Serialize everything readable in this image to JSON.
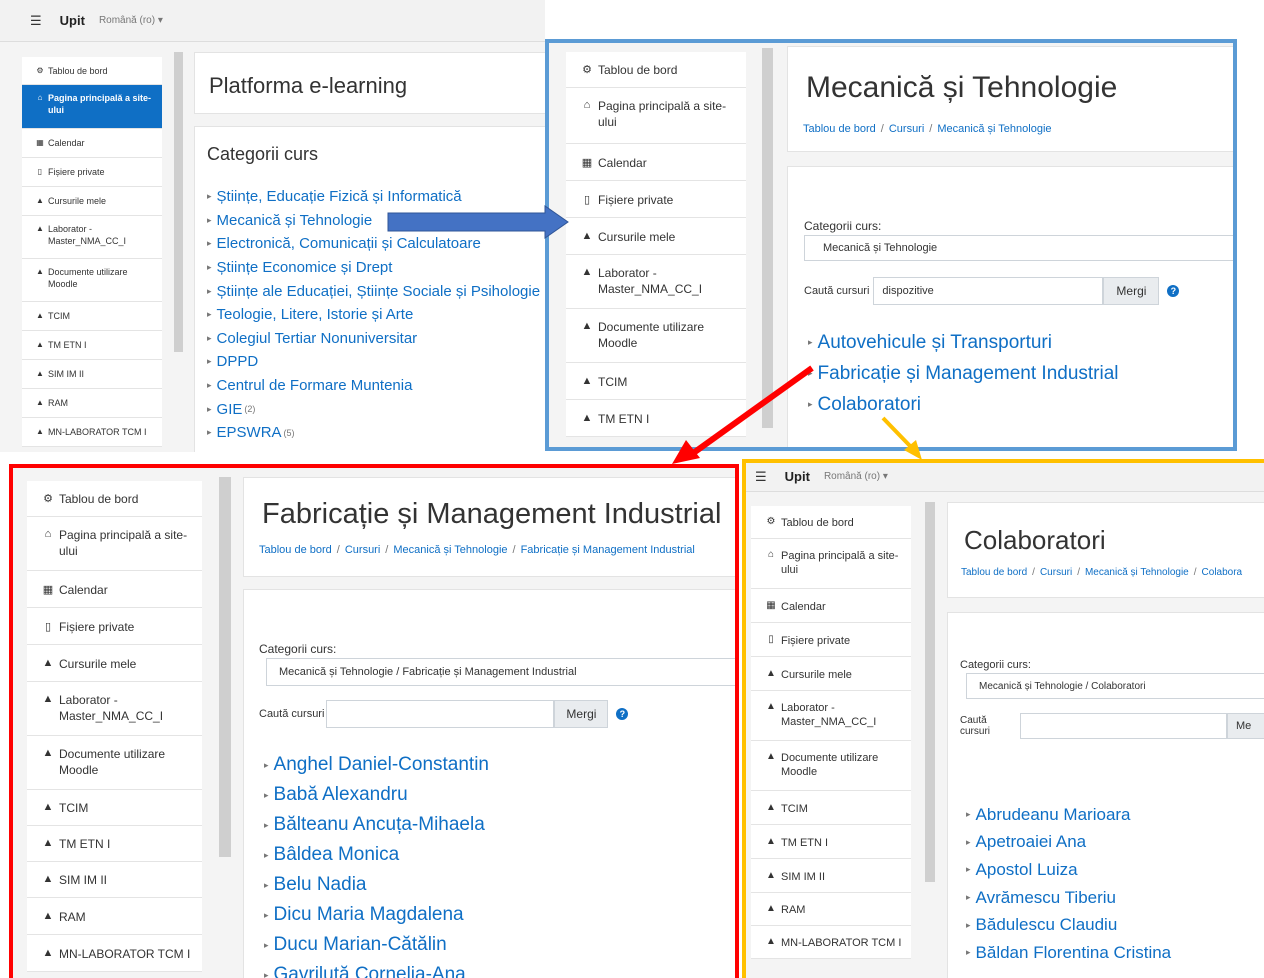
{
  "navbar": {
    "menu_icon": "hamburger-icon",
    "brand": "Upit",
    "lang": "Română (ro) ▾"
  },
  "sidebar_items": [
    {
      "icon": "dashboard-icon",
      "label": "Tablou de bord"
    },
    {
      "icon": "home-icon",
      "label": "Pagina principală a site-ului"
    },
    {
      "icon": "calendar-icon",
      "label": "Calendar"
    },
    {
      "icon": "file-icon",
      "label": "Fișiere private"
    },
    {
      "icon": "graduation-cap-icon",
      "label": "Cursurile mele"
    },
    {
      "icon": "graduation-cap-icon",
      "label": "Laborator - Master_NMA_CC_I"
    },
    {
      "icon": "graduation-cap-icon",
      "label": "Documente utilizare Moodle"
    },
    {
      "icon": "graduation-cap-icon",
      "label": "TCIM"
    },
    {
      "icon": "graduation-cap-icon",
      "label": "TM ETN I"
    },
    {
      "icon": "graduation-cap-icon",
      "label": "SIM IM II"
    },
    {
      "icon": "graduation-cap-icon",
      "label": "RAM"
    },
    {
      "icon": "graduation-cap-icon",
      "label": "MN-LABORATOR TCM I"
    }
  ],
  "panel1": {
    "title": "Platforma e-learning",
    "categories_heading": "Categorii curs",
    "categories": [
      {
        "name": "Științe, Educație Fizică și Informatică",
        "count": ""
      },
      {
        "name": "Mecanică și Tehnologie",
        "count": ""
      },
      {
        "name": "Electronică, Comunicații și Calculatoare",
        "count": ""
      },
      {
        "name": "Științe Economice și Drept",
        "count": ""
      },
      {
        "name": "Științe ale Educației, Științe Sociale și Psihologie",
        "count": ""
      },
      {
        "name": "Teologie, Litere, Istorie și Arte",
        "count": ""
      },
      {
        "name": "Colegiul Tertiar Nonuniversitar",
        "count": ""
      },
      {
        "name": "DPPD",
        "count": ""
      },
      {
        "name": "Centrul de Formare Muntenia",
        "count": ""
      },
      {
        "name": "GIE",
        "count": "(2)"
      },
      {
        "name": "EPSWRA",
        "count": "(5)"
      }
    ]
  },
  "panel2": {
    "title": "Mecanică și Tehnologie",
    "breadcrumb": [
      "Tablou de bord",
      "Cursuri",
      "Mecanică și Tehnologie"
    ],
    "categories_label": "Categorii curs:",
    "category_selected": "Mecanică și Tehnologie",
    "search_label": "Caută cursuri",
    "search_value": "dispozitive",
    "search_button": "Mergi",
    "subcategories": [
      "Autovehicule și Transporturi",
      "Fabricație și Management Industrial",
      "Colaboratori"
    ]
  },
  "panel3": {
    "title": "Fabricație și Management Industrial",
    "breadcrumb": [
      "Tablou de bord",
      "Cursuri",
      "Mecanică și Tehnologie",
      "Fabricație și Management Industrial"
    ],
    "categories_label": "Categorii curs:",
    "category_selected": "Mecanică și Tehnologie / Fabricație și Management Industrial",
    "search_label": "Caută cursuri",
    "search_value": "",
    "search_button": "Mergi",
    "courses": [
      "Anghel Daniel-Constantin",
      "Babă Alexandru",
      "Bălteanu Ancuța-Mihaela",
      "Bâldea Monica",
      "Belu Nadia",
      "Dicu Maria Magdalena",
      "Ducu Marian-Cătălin",
      "Gavriluță Cornelia-Ana"
    ]
  },
  "panel4": {
    "title": "Colaboratori",
    "breadcrumb": [
      "Tablou de bord",
      "Cursuri",
      "Mecanică și Tehnologie",
      "Colabora"
    ],
    "categories_label": "Categorii curs:",
    "category_selected": "Mecanică și Tehnologie / Colaboratori",
    "search_label": "Caută cursuri",
    "search_value": "",
    "search_button": "Me",
    "courses": [
      "Abrudeanu Marioara",
      "Apetroaiei Ana",
      "Apostol Luiza",
      "Avrămescu Tiberiu",
      "Bădulescu Claudiu",
      "Băldan Florentina Cristina"
    ]
  },
  "colors": {
    "moodle_blue": "#0f6fc5",
    "frame_blue": "#5b9bd5",
    "frame_red": "#ff0000",
    "frame_yellow": "#ffc000",
    "arrow_blue": "#4472c4"
  }
}
